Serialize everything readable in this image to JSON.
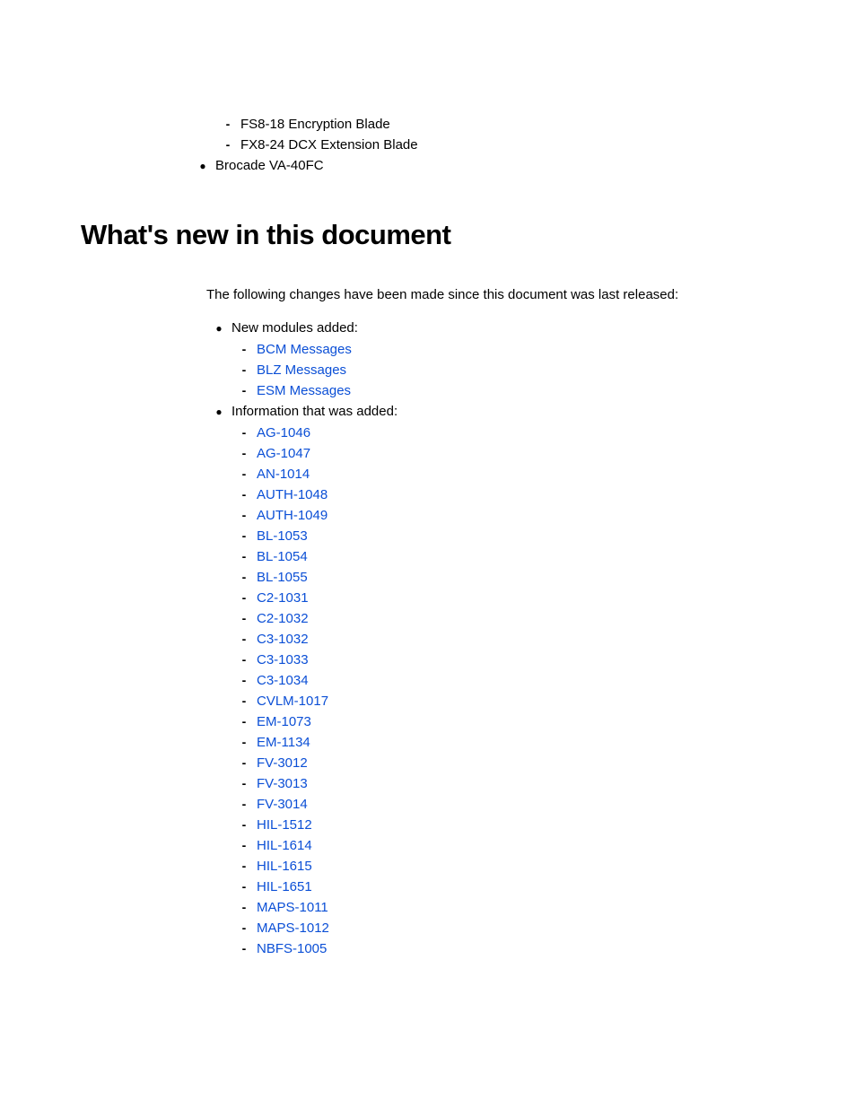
{
  "top_items": [
    "FS8-18 Encryption Blade",
    "FX8-24 DCX Extension Blade"
  ],
  "top_bullet": "Brocade VA-40FC",
  "heading": "What's new in this document",
  "intro": "The following changes have been made since this document was last released:",
  "sections": [
    {
      "label": "New modules added:",
      "links": [
        "BCM Messages",
        "BLZ Messages",
        "ESM Messages"
      ]
    },
    {
      "label": "Information that was added:",
      "links": [
        "AG-1046",
        "AG-1047",
        "AN-1014",
        "AUTH-1048",
        "AUTH-1049",
        "BL-1053",
        "BL-1054",
        "BL-1055",
        "C2-1031",
        "C2-1032",
        "C3-1032",
        "C3-1033",
        "C3-1034",
        "CVLM-1017",
        "EM-1073",
        "EM-1134",
        "FV-3012",
        "FV-3013",
        "FV-3014",
        "HIL-1512",
        "HIL-1614",
        "HIL-1615",
        "HIL-1651",
        "MAPS-1011",
        "MAPS-1012",
        "NBFS-1005"
      ]
    }
  ]
}
